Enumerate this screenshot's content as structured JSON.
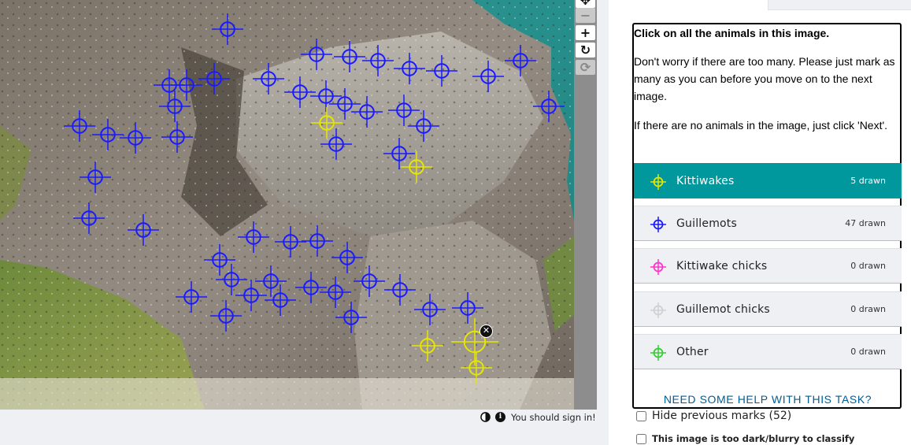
{
  "toolbar": {
    "tools": [
      {
        "name": "pan-icon",
        "glyph": "✥",
        "enabled": true
      },
      {
        "name": "zoom-out-icon",
        "glyph": "−",
        "enabled": false
      },
      {
        "name": "zoom-in-icon",
        "glyph": "+",
        "enabled": true
      },
      {
        "name": "rotate-icon",
        "glyph": "↻",
        "enabled": true
      },
      {
        "name": "reset-icon",
        "glyph": "⟳",
        "enabled": false
      }
    ]
  },
  "status": {
    "signin_text": "You should sign in!",
    "contrast_icon": "contrast-icon",
    "info_icon": "info-icon",
    "info_glyph": "i"
  },
  "task": {
    "instruction": "Click on all the animals in this image.",
    "help_paragraph_1": "Don't worry if there are too many. Please just mark as many as you can before you move on to the next image.",
    "help_paragraph_2": "If there are no animals in the image, just click 'Next'.",
    "help_link": "NEED SOME HELP WITH THIS TASK?"
  },
  "answers": [
    {
      "label": "Kittiwakes",
      "count": "5 drawn",
      "color": "#e6e600",
      "active": true
    },
    {
      "label": "Guillemots",
      "count": "47 drawn",
      "color": "#1a1aff",
      "active": false
    },
    {
      "label": "Kittiwake chicks",
      "count": "0 drawn",
      "color": "#ff33cc",
      "active": false
    },
    {
      "label": "Guillemot chicks",
      "count": "0 drawn",
      "color": "#d0d0d0",
      "active": false
    },
    {
      "label": "Other",
      "count": "0 drawn",
      "color": "#33cc33",
      "active": false
    }
  ],
  "options": {
    "hide_previous_marks": "Hide previous marks (52)",
    "too_dark": "This image is too dark/blurry to classify"
  },
  "colors": {
    "guillemot_mark": "#1a1aff",
    "kittiwake_mark": "#e6e600",
    "active_answer_bg": "#00979d"
  },
  "delete_glyph": "✕"
}
